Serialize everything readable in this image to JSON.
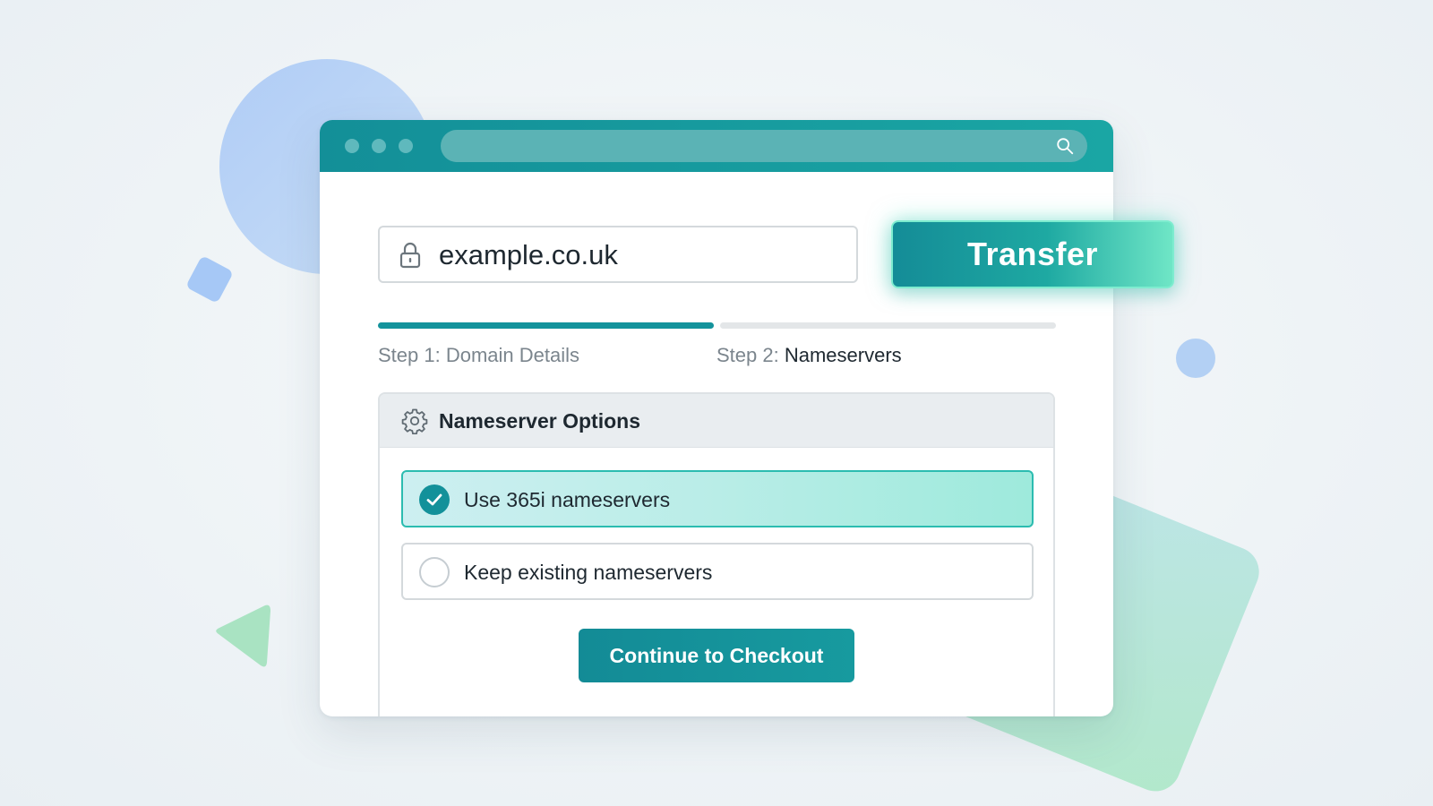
{
  "browser": {
    "url": ""
  },
  "domain_field": {
    "value": "example.co.uk",
    "icon": "lock-icon"
  },
  "transfer_button": {
    "label": "Transfer"
  },
  "steps": {
    "progress": 0.5,
    "items": [
      {
        "prefix": "Step 1: ",
        "name": "Domain Details",
        "complete": true
      },
      {
        "prefix": "Step 2: ",
        "name": "Nameservers",
        "active": true
      }
    ]
  },
  "nameserver_panel": {
    "title": "Nameserver Options",
    "icon": "gear-icon",
    "options": [
      {
        "label": "Use 365i nameservers",
        "selected": true
      },
      {
        "label": "Keep existing nameservers",
        "selected": false
      }
    ],
    "checkout_label": "Continue to Checkout"
  },
  "colors": {
    "accent": "#14939c",
    "accent_light": "#6fe6c6",
    "background": "#eef3f6"
  }
}
